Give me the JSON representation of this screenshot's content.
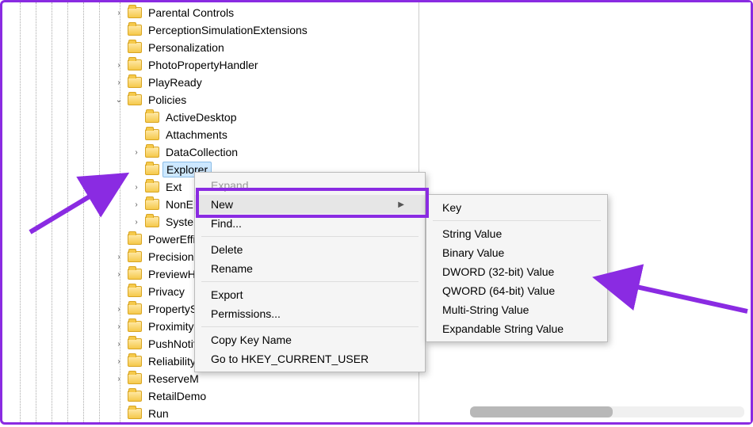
{
  "tree": {
    "items": [
      {
        "label": "Parental Controls",
        "exp": "closed",
        "indent": 1
      },
      {
        "label": "PerceptionSimulationExtensions",
        "exp": "none",
        "indent": 1
      },
      {
        "label": "Personalization",
        "exp": "none",
        "indent": 1
      },
      {
        "label": "PhotoPropertyHandler",
        "exp": "closed",
        "indent": 1
      },
      {
        "label": "PlayReady",
        "exp": "closed",
        "indent": 1
      },
      {
        "label": "Policies",
        "exp": "open",
        "indent": 1
      },
      {
        "label": "ActiveDesktop",
        "exp": "none",
        "indent": 2
      },
      {
        "label": "Attachments",
        "exp": "none",
        "indent": 2
      },
      {
        "label": "DataCollection",
        "exp": "closed",
        "indent": 2
      },
      {
        "label": "Explorer",
        "exp": "none",
        "indent": 2,
        "selected": true
      },
      {
        "label": "Ext",
        "exp": "closed",
        "indent": 2
      },
      {
        "label": "NonEn",
        "exp": "closed",
        "indent": 2,
        "truncated": true
      },
      {
        "label": "System",
        "exp": "closed",
        "indent": 2,
        "truncated": true
      },
      {
        "label": "PowerEffi",
        "exp": "none",
        "indent": 1,
        "truncated": true
      },
      {
        "label": "PrecisionT",
        "exp": "closed",
        "indent": 1,
        "truncated": true
      },
      {
        "label": "PreviewH",
        "exp": "closed",
        "indent": 1,
        "truncated": true
      },
      {
        "label": "Privacy",
        "exp": "none",
        "indent": 1
      },
      {
        "label": "PropertyS",
        "exp": "closed",
        "indent": 1,
        "truncated": true
      },
      {
        "label": "Proximity",
        "exp": "closed",
        "indent": 1
      },
      {
        "label": "PushNotif",
        "exp": "closed",
        "indent": 1,
        "truncated": true
      },
      {
        "label": "Reliability",
        "exp": "closed",
        "indent": 1,
        "truncated": true
      },
      {
        "label": "ReserveM",
        "exp": "closed",
        "indent": 1,
        "truncated": true
      },
      {
        "label": "RetailDemo",
        "exp": "none",
        "indent": 1
      },
      {
        "label": "Run",
        "exp": "none",
        "indent": 1
      }
    ]
  },
  "contextMenu": {
    "expand": "Expand",
    "new": "New",
    "find": "Find...",
    "delete": "Delete",
    "rename": "Rename",
    "export": "Export",
    "permissions": "Permissions...",
    "copyKeyName": "Copy Key Name",
    "goTo": "Go to HKEY_CURRENT_USER"
  },
  "newSubmenu": {
    "key": "Key",
    "string": "String Value",
    "binary": "Binary Value",
    "dword": "DWORD (32-bit) Value",
    "qword": "QWORD (64-bit) Value",
    "multi": "Multi-String Value",
    "expandable": "Expandable String Value"
  },
  "annotations": {
    "arrow1_target": "Explorer",
    "arrow2_target": "DWORD (32-bit) Value",
    "highlight_target": "New"
  }
}
